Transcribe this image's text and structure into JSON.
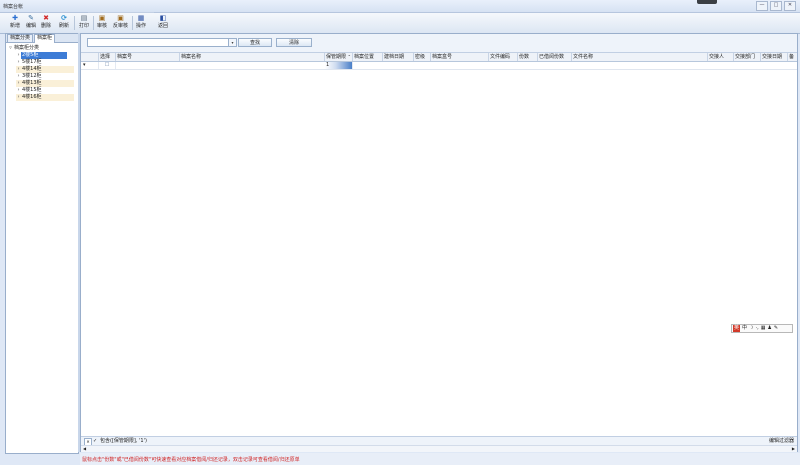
{
  "window": {
    "title": "档案台帐",
    "controls": [
      "—",
      "□",
      "✕"
    ]
  },
  "toolbar": {
    "buttons": [
      {
        "label": "新增",
        "icon": "plus-icon",
        "color": "#2a6fd1"
      },
      {
        "label": "编辑",
        "icon": "edit-icon",
        "color": "#3a6e9e"
      },
      {
        "label": "删除",
        "icon": "delete-icon",
        "color": "#d12a2a"
      },
      {
        "label": "刷新",
        "icon": "refresh-icon",
        "color": "#2a8fd1"
      },
      {
        "label": "打印",
        "icon": "print-icon",
        "color": "#556677"
      },
      {
        "label": "审核",
        "icon": "approve-icon",
        "color": "#a06a1a"
      },
      {
        "label": "反审核",
        "icon": "unapprove-icon",
        "color": "#a06a1a"
      },
      {
        "label": "操作",
        "icon": "operate-icon",
        "color": "#2a4fa1"
      },
      {
        "label": "返回",
        "icon": "return-icon",
        "color": "#2a4fa1"
      }
    ]
  },
  "left": {
    "tabs": [
      "档案分类",
      "档案柜"
    ],
    "tree": {
      "root": "档案柜分类",
      "items": [
        "2楼5柜",
        "5楼17柜",
        "4楼14柜",
        "3楼12柜",
        "4楼13柜",
        "4楼15柜",
        "4楼16柜"
      ]
    }
  },
  "search": {
    "value": "",
    "query_label": "查找",
    "clear_label": "清除"
  },
  "grid": {
    "columns": [
      "选择",
      "档案号",
      "档案名称",
      "保管期限",
      "档案位置",
      "建档日期",
      "密级",
      "档案盒号",
      "文件编码",
      "份数",
      "已借阅份数",
      "文件名称",
      "交接人",
      "交接部门",
      "交接日期",
      "备"
    ],
    "filter_row": {
      "checkbox": "☐",
      "keep_period": "1"
    }
  },
  "ime": {
    "items": [
      "英",
      "中",
      "☽",
      "·,",
      "▦",
      "♟",
      "✎"
    ]
  },
  "footer": {
    "filter_text": "包含([保管期限], '1')",
    "edit_filter_label": "编辑过滤器"
  },
  "status": {
    "message": "鼠标点击\"份数\"或\"已借阅份数\"可快速查看对应档案借阅/归还记录，双击记录可查看借阅/归还原单"
  },
  "accent": "#3d7cd6"
}
